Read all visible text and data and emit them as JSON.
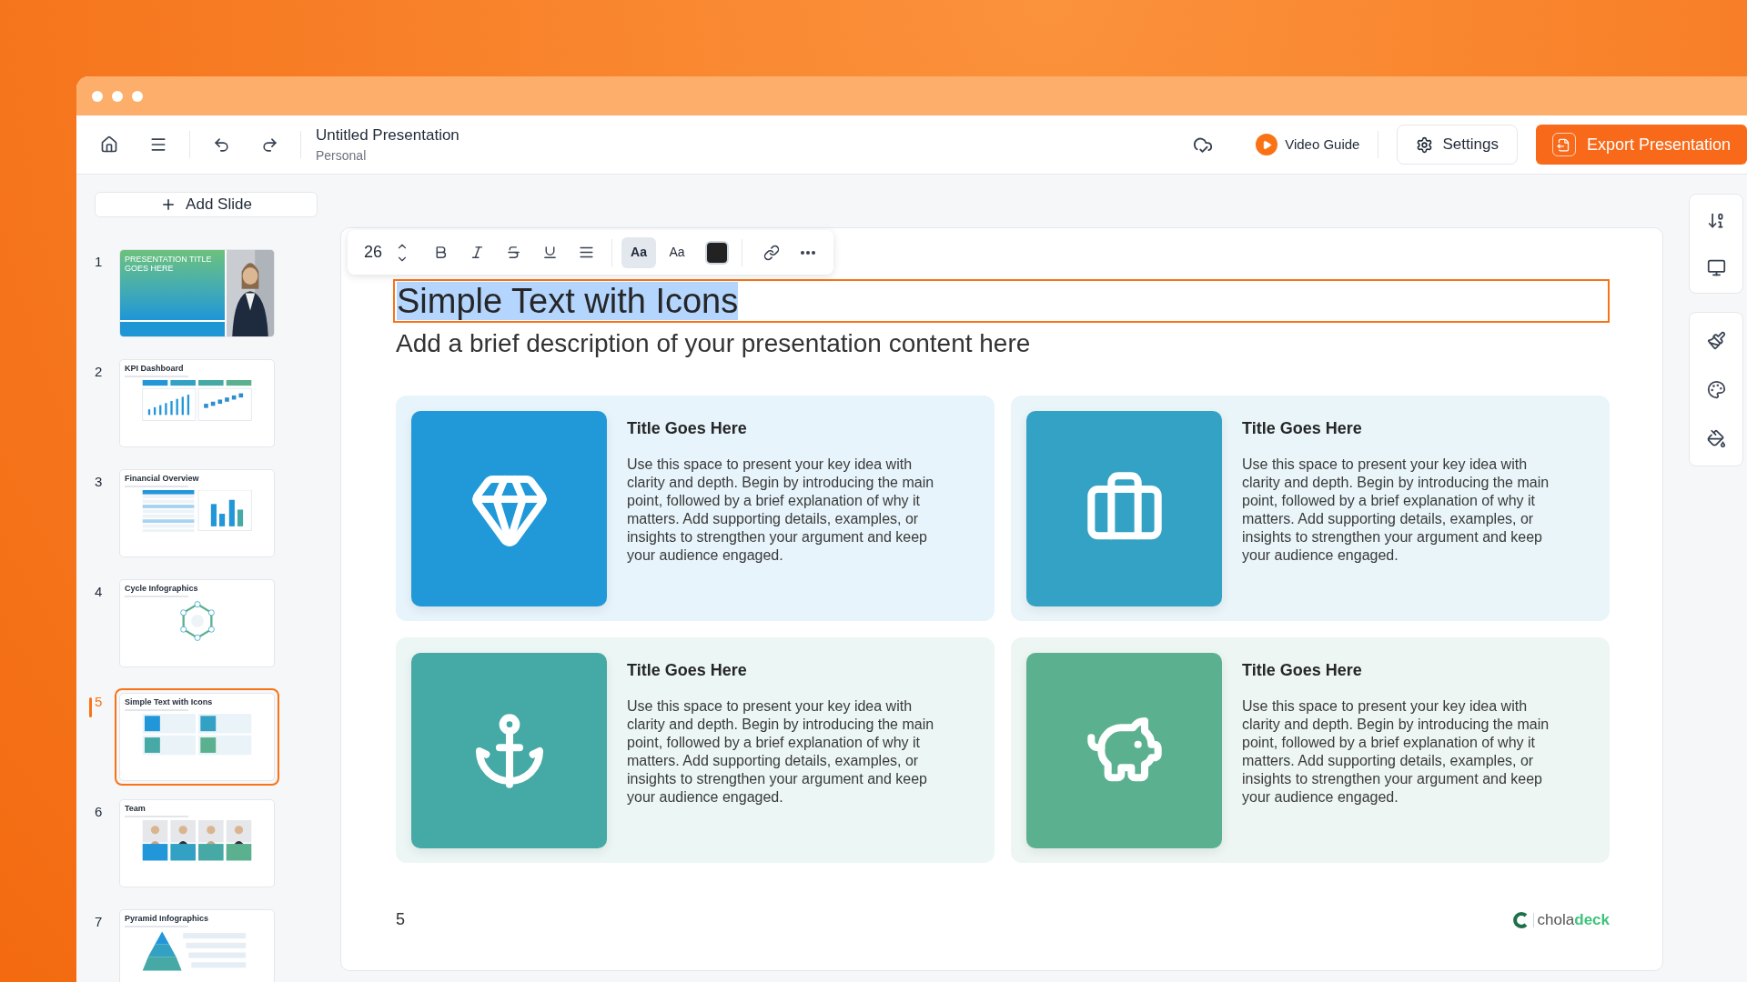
{
  "header": {
    "title": "Untitled Presentation",
    "subtitle": "Personal",
    "video_guide": "Video Guide",
    "settings": "Settings",
    "export": "Export Presentation"
  },
  "sidebar": {
    "add_slide": "Add Slide",
    "slides": [
      {
        "number": "1",
        "title": "PRESENTATION TITLE GOES HERE",
        "kind": "cover",
        "selected": false
      },
      {
        "number": "2",
        "title": "KPI Dashboard",
        "kind": "dashboard",
        "selected": false
      },
      {
        "number": "3",
        "title": "Financial Overview",
        "kind": "table",
        "selected": false
      },
      {
        "number": "4",
        "title": "Cycle Infographics",
        "kind": "cycle",
        "selected": false
      },
      {
        "number": "5",
        "title": "Simple Text with Icons",
        "kind": "icons",
        "selected": true
      },
      {
        "number": "6",
        "title": "Team",
        "kind": "team",
        "selected": false
      },
      {
        "number": "7",
        "title": "Pyramid Infographics",
        "kind": "pyramid",
        "selected": false
      }
    ]
  },
  "toolbar": {
    "font_size": "26",
    "case_buttons": [
      {
        "label": "Aa",
        "selected": true
      },
      {
        "label": "Aa",
        "selected": false
      }
    ]
  },
  "slide": {
    "title": "Simple Text with Icons",
    "title_selected": true,
    "description": "Add a brief description of your presentation content here",
    "cards": [
      {
        "color": "#2199d9",
        "title": "Title Goes Here",
        "body": "Use this space to present your key idea with clarity and depth. Begin by introducing the main point, followed by a brief explanation of why it matters. Add supporting details, examples, or insights to strengthen your argument and keep your audience engaged."
      },
      {
        "color": "#33a2c4",
        "title": "Title Goes Here",
        "body": "Use this space to present your key idea with clarity and depth. Begin by introducing the main point, followed by a brief explanation of why it matters. Add supporting details, examples, or insights to strengthen your argument and keep your audience engaged."
      },
      {
        "color": "#45a9a6",
        "title": "Title Goes Here",
        "body": "Use this space to present your key idea with clarity and depth. Begin by introducing the main point, followed by a brief explanation of why it matters. Add supporting details, examples, or insights to strengthen your argument and keep your audience engaged."
      },
      {
        "color": "#5bb18f",
        "title": "Title Goes Here",
        "body": "Use this space to present your key idea with clarity and depth. Begin by introducing the main point, followed by a brief explanation of why it matters. Add supporting details, examples, or insights to strengthen your argument and keep your audience engaged."
      }
    ],
    "page_number": "5",
    "logo_text_light": "chola",
    "logo_text_bold": "deck"
  }
}
